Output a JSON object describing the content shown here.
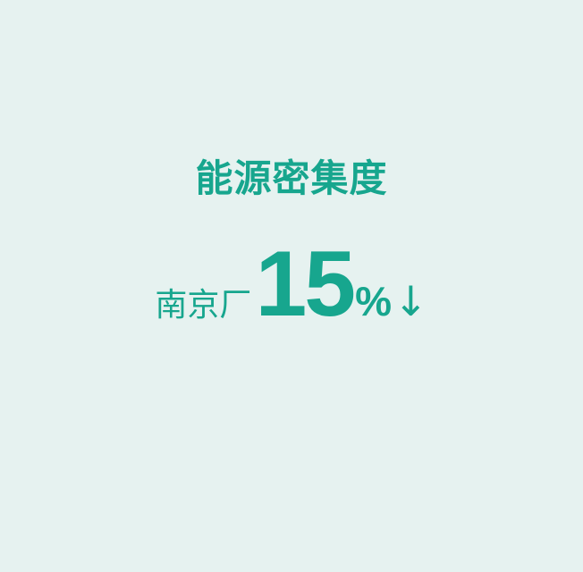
{
  "title": "能源密集度",
  "stat": {
    "plant": "南京厂",
    "value": "15",
    "unit": "%",
    "trend_symbol": "↓",
    "trend": "down"
  },
  "colors": {
    "background": "#e6f2f0",
    "accent": "#17a68e"
  }
}
